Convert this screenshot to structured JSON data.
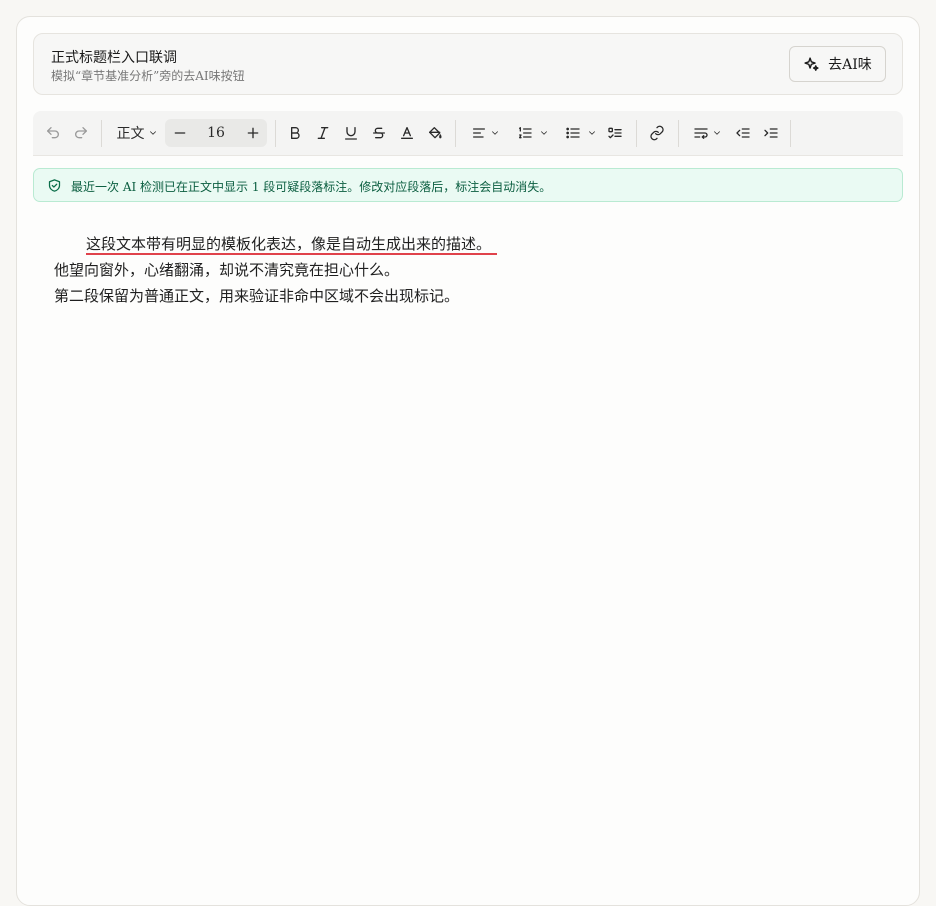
{
  "header": {
    "title": "正式标题栏入口联调",
    "subtitle": "模拟“章节基准分析”旁的去AI味按钮",
    "deai_button_label": "去AI味"
  },
  "toolbar": {
    "paragraph_style": "正文",
    "font_size": "16"
  },
  "notice": {
    "text": "最近一次 AI 检测已在正文中显示 1 段可疑段落标注。修改对应段落后，标注会自动消失。"
  },
  "editor": {
    "flagged_sentence": "这段文本带有明显的模板化表达，像是自动生成出来的描述。",
    "line2": "他望向窗外，心绪翻涌，却说不清究竟在担心什么。",
    "line3": "第二段保留为普通正文，用来验证非命中区域不会出现标记。"
  },
  "colors": {
    "flag_underline": "#e0424b",
    "notice_bg": "#eafaf3",
    "notice_text": "#0b5e40"
  },
  "icons": [
    "undo-icon",
    "redo-icon",
    "minus-icon",
    "plus-icon",
    "bold-icon",
    "italic-icon",
    "underline-icon",
    "strikethrough-icon",
    "text-color-icon",
    "highlight-icon",
    "align-icon",
    "ordered-list-icon",
    "bullet-list-icon",
    "task-list-icon",
    "link-icon",
    "line-spacing-icon",
    "outdent-icon",
    "indent-icon",
    "sparkle-icon",
    "shield-check-icon"
  ]
}
